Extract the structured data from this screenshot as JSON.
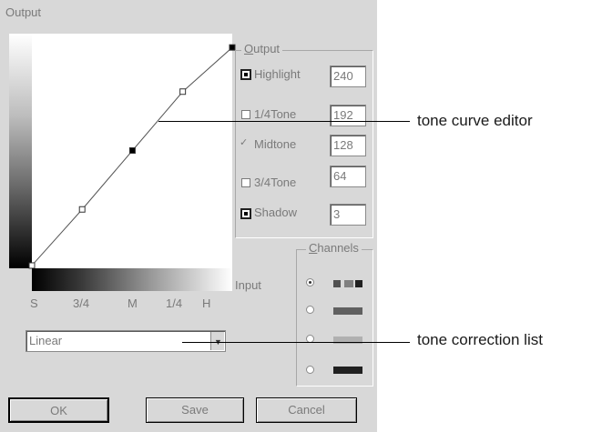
{
  "graph": {
    "title": "Output",
    "input_label": "Input",
    "input_ticks": [
      "S",
      "3/4",
      "M",
      "1/4",
      "H"
    ],
    "curve_points": [
      {
        "input": 0,
        "output": 3
      },
      {
        "input": 64,
        "output": 64
      },
      {
        "input": 128,
        "output": 128
      },
      {
        "input": 192,
        "output": 192
      },
      {
        "input": 255,
        "output": 240
      }
    ]
  },
  "output_group": {
    "legend": "Output",
    "rows": [
      {
        "label": "Highlight",
        "value": "240",
        "checked": true
      },
      {
        "label": "1/4Tone",
        "value": "192",
        "checked": false
      },
      {
        "label": "Midtone",
        "value": "128",
        "checked": true
      },
      {
        "label": "3/4Tone",
        "value": "64",
        "checked": false
      },
      {
        "label": "Shadow",
        "value": "3",
        "checked": true
      }
    ]
  },
  "channels": {
    "legend": "Channels",
    "options": [
      {
        "name": "composite",
        "selected": true,
        "colors": [
          "#505050",
          "#808080",
          "#202020"
        ]
      },
      {
        "name": "channel-2",
        "selected": false,
        "colors": [
          "#606060"
        ]
      },
      {
        "name": "channel-3",
        "selected": false,
        "colors": [
          "#b0b0b0"
        ]
      },
      {
        "name": "channel-4",
        "selected": false,
        "colors": [
          "#202020"
        ]
      }
    ]
  },
  "tone_list": {
    "selected": "Linear"
  },
  "buttons": {
    "ok": "OK",
    "save": "Save",
    "cancel": "Cancel"
  },
  "annotations": {
    "curve_editor": "tone curve editor",
    "correction_list": "tone correction list"
  }
}
